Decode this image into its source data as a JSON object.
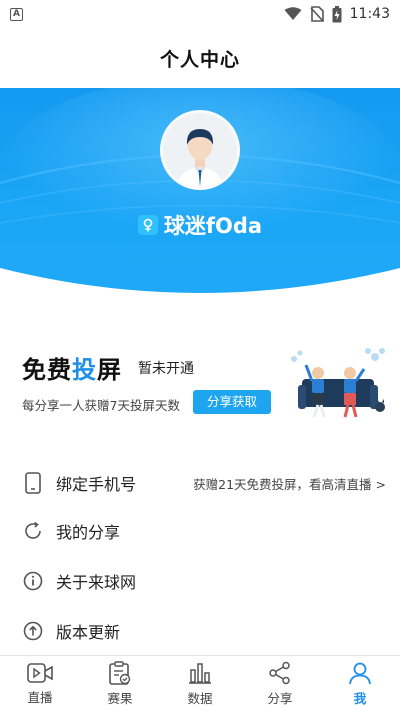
{
  "status_bar": {
    "time": "11:43"
  },
  "header": {
    "title": "个人中心"
  },
  "profile": {
    "username": "球迷fOda"
  },
  "promo": {
    "title_part1": "免费",
    "title_part2": "投",
    "title_part3": "屏",
    "status": "暂未开通",
    "description": "每分享一人获赠7天投屏天数",
    "button_label": "分享获取"
  },
  "menu": {
    "items": [
      {
        "label": "绑定手机号",
        "hint": "获赠21天免费投屏，看高清直播 >",
        "icon": "phone-icon"
      },
      {
        "label": "我的分享",
        "hint": "",
        "icon": "share-refresh-icon"
      },
      {
        "label": "关于来球网",
        "hint": "",
        "icon": "info-icon"
      },
      {
        "label": "版本更新",
        "hint": "",
        "icon": "update-icon"
      }
    ]
  },
  "tabs": [
    {
      "label": "直播",
      "icon": "live-video-icon",
      "active": false
    },
    {
      "label": "赛果",
      "icon": "results-clipboard-icon",
      "active": false
    },
    {
      "label": "数据",
      "icon": "bar-chart-icon",
      "active": false
    },
    {
      "label": "分享",
      "icon": "share-icon",
      "active": false
    },
    {
      "label": "我",
      "icon": "profile-icon",
      "active": true
    }
  ],
  "colors": {
    "accent": "#1f8fe8",
    "banner": "#1aa3f5",
    "button": "#1ea5f0"
  }
}
